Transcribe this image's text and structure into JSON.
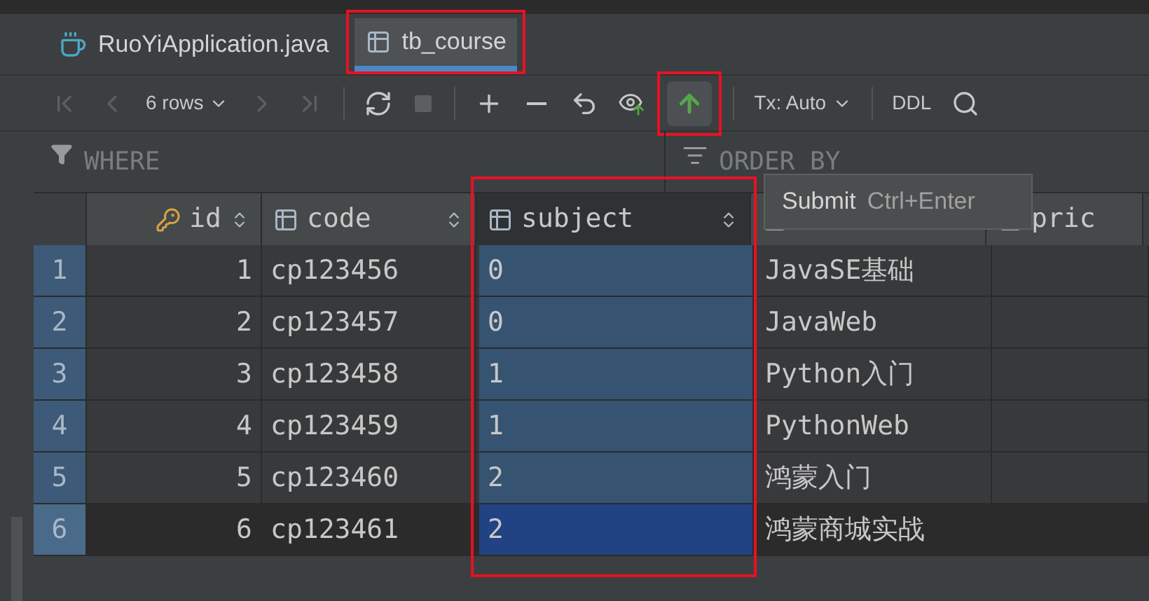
{
  "tabs": [
    {
      "kind": "java",
      "label": "RuoYiApplication.java",
      "selected": false,
      "highlighted": false
    },
    {
      "kind": "table",
      "label": "tb_course",
      "selected": true,
      "highlighted": true
    }
  ],
  "toolbar": [
    {
      "kind": "first",
      "disabled": true,
      "highlighted": false
    },
    {
      "kind": "prev",
      "disabled": true,
      "highlighted": false
    },
    {
      "kind": "rows",
      "label": "6 rows",
      "disabled": false,
      "highlighted": false
    },
    {
      "kind": "next",
      "disabled": true,
      "highlighted": false
    },
    {
      "kind": "last",
      "disabled": true,
      "highlighted": false
    },
    {
      "kind": "sep"
    },
    {
      "kind": "reload",
      "disabled": false,
      "highlighted": false
    },
    {
      "kind": "stop",
      "disabled": true,
      "highlighted": false
    },
    {
      "kind": "sep"
    },
    {
      "kind": "add",
      "disabled": false,
      "highlighted": false
    },
    {
      "kind": "remove",
      "disabled": false,
      "highlighted": false
    },
    {
      "kind": "revert",
      "disabled": false,
      "highlighted": false
    },
    {
      "kind": "preview",
      "disabled": false,
      "highlighted": false
    },
    {
      "kind": "submit",
      "disabled": false,
      "highlighted": true
    },
    {
      "kind": "sep"
    },
    {
      "kind": "tx",
      "label": "Tx: Auto",
      "disabled": false,
      "highlighted": false
    },
    {
      "kind": "sep"
    },
    {
      "kind": "ddl",
      "label": "DDL",
      "disabled": false,
      "highlighted": false
    },
    {
      "kind": "search",
      "disabled": false,
      "highlighted": false
    }
  ],
  "filter": {
    "where": "WHERE",
    "order_by": "ORDER BY"
  },
  "tooltip": {
    "label": "Submit",
    "shortcut": "Ctrl+Enter"
  },
  "table": {
    "columns": [
      {
        "kind": "key",
        "label": "id",
        "sortable": true,
        "selected": false,
        "highlighted": false
      },
      {
        "kind": "plain",
        "label": "code",
        "sortable": true,
        "selected": false,
        "highlighted": false
      },
      {
        "kind": "plain",
        "label": "subject",
        "sortable": true,
        "selected": true,
        "highlighted": true
      },
      {
        "kind": "plain",
        "selected": false,
        "highlighted": false
      },
      {
        "kind": "plain",
        "label": "pric",
        "sortable": false,
        "selected": false,
        "highlighted": false
      }
    ],
    "rows": [
      {
        "number": "1",
        "current": false,
        "cells": [
          "1",
          "cp123456",
          "0",
          "JavaSE基础"
        ]
      },
      {
        "number": "2",
        "current": false,
        "cells": [
          "2",
          "cp123457",
          "0",
          "JavaWeb"
        ]
      },
      {
        "number": "3",
        "current": false,
        "cells": [
          "3",
          "cp123458",
          "1",
          "Python入门"
        ]
      },
      {
        "number": "4",
        "current": false,
        "cells": [
          "4",
          "cp123459",
          "1",
          "PythonWeb"
        ]
      },
      {
        "number": "5",
        "current": false,
        "cells": [
          "5",
          "cp123460",
          "2",
          "鸿蒙入门"
        ]
      },
      {
        "number": "6",
        "current": true,
        "cells": [
          "6",
          "cp123461",
          "2",
          "鸿蒙商城实战"
        ]
      }
    ]
  }
}
